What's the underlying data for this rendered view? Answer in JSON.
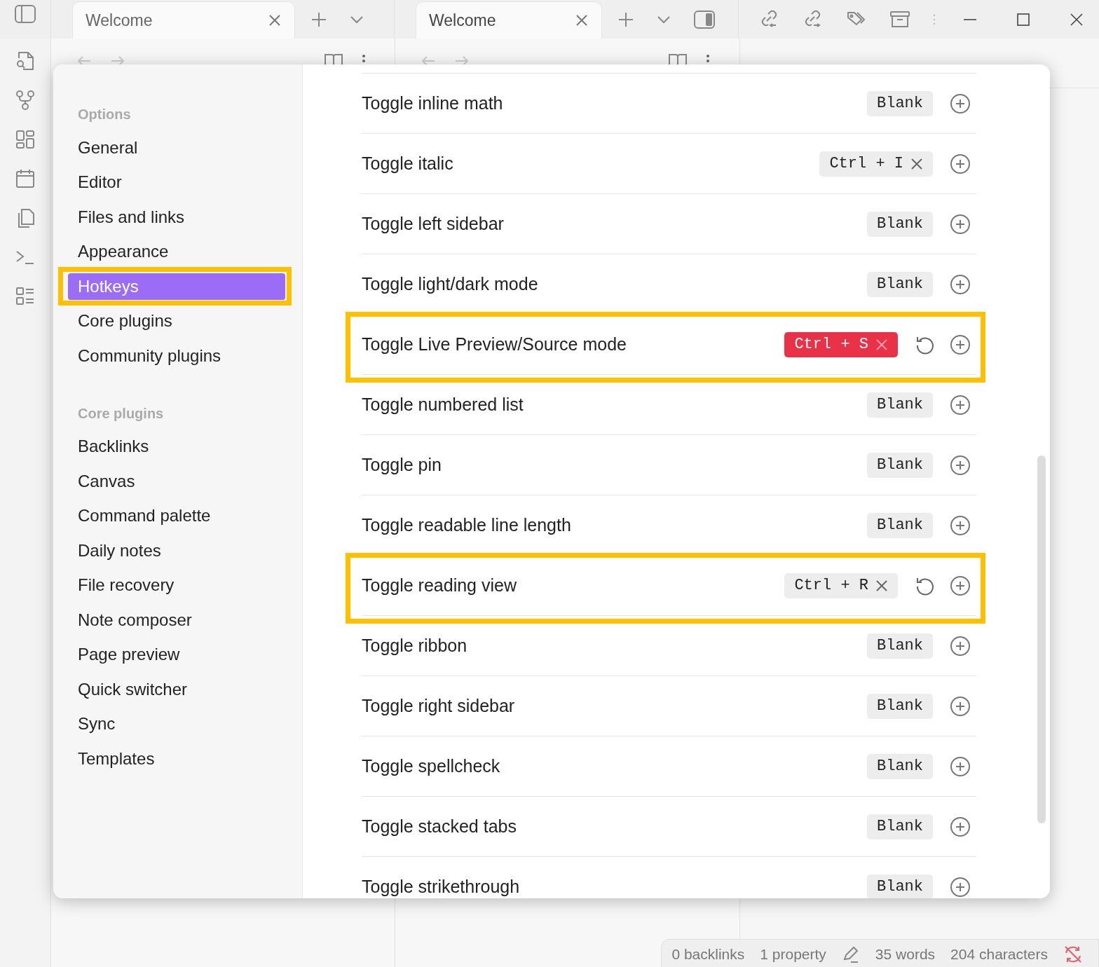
{
  "top_bar": {
    "panes": [
      {
        "tabs": [
          {
            "title": "Welcome",
            "selected": true
          }
        ]
      },
      {
        "tabs": [
          {
            "title": "Welcome",
            "selected": true
          }
        ]
      }
    ]
  },
  "settings": {
    "nav": [
      {
        "heading": "Options",
        "items": [
          {
            "label": "General",
            "selected": false,
            "highlighted": false
          },
          {
            "label": "Editor",
            "selected": false,
            "highlighted": false
          },
          {
            "label": "Files and links",
            "selected": false,
            "highlighted": false
          },
          {
            "label": "Appearance",
            "selected": false,
            "highlighted": false
          },
          {
            "label": "Hotkeys",
            "selected": true,
            "highlighted": true
          },
          {
            "label": "Core plugins",
            "selected": false,
            "highlighted": false
          },
          {
            "label": "Community plugins",
            "selected": false,
            "highlighted": false
          }
        ]
      },
      {
        "heading": "Core plugins",
        "items": [
          {
            "label": "Backlinks",
            "selected": false,
            "highlighted": false
          },
          {
            "label": "Canvas",
            "selected": false,
            "highlighted": false
          },
          {
            "label": "Command palette",
            "selected": false,
            "highlighted": false
          },
          {
            "label": "Daily notes",
            "selected": false,
            "highlighted": false
          },
          {
            "label": "File recovery",
            "selected": false,
            "highlighted": false
          },
          {
            "label": "Note composer",
            "selected": false,
            "highlighted": false
          },
          {
            "label": "Page preview",
            "selected": false,
            "highlighted": false
          },
          {
            "label": "Quick switcher",
            "selected": false,
            "highlighted": false
          },
          {
            "label": "Sync",
            "selected": false,
            "highlighted": false
          },
          {
            "label": "Templates",
            "selected": false,
            "highlighted": false
          }
        ]
      }
    ],
    "hotkeys": [
      {
        "command": "Toggle inline math",
        "binding": "Blank",
        "kind": "blank",
        "conflict": false,
        "customized": false,
        "highlighted": false
      },
      {
        "command": "Toggle italic",
        "binding": "Ctrl + I",
        "kind": "keys",
        "conflict": false,
        "customized": false,
        "highlighted": false
      },
      {
        "command": "Toggle left sidebar",
        "binding": "Blank",
        "kind": "blank",
        "conflict": false,
        "customized": false,
        "highlighted": false
      },
      {
        "command": "Toggle light/dark mode",
        "binding": "Blank",
        "kind": "blank",
        "conflict": false,
        "customized": false,
        "highlighted": false
      },
      {
        "command": "Toggle Live Preview/Source mode",
        "binding": "Ctrl + S",
        "kind": "keys",
        "conflict": true,
        "customized": true,
        "highlighted": true
      },
      {
        "command": "Toggle numbered list",
        "binding": "Blank",
        "kind": "blank",
        "conflict": false,
        "customized": false,
        "highlighted": false
      },
      {
        "command": "Toggle pin",
        "binding": "Blank",
        "kind": "blank",
        "conflict": false,
        "customized": false,
        "highlighted": false
      },
      {
        "command": "Toggle readable line length",
        "binding": "Blank",
        "kind": "blank",
        "conflict": false,
        "customized": false,
        "highlighted": false
      },
      {
        "command": "Toggle reading view",
        "binding": "Ctrl + R",
        "kind": "keys",
        "conflict": false,
        "customized": true,
        "highlighted": true
      },
      {
        "command": "Toggle ribbon",
        "binding": "Blank",
        "kind": "blank",
        "conflict": false,
        "customized": false,
        "highlighted": false
      },
      {
        "command": "Toggle right sidebar",
        "binding": "Blank",
        "kind": "blank",
        "conflict": false,
        "customized": false,
        "highlighted": false
      },
      {
        "command": "Toggle spellcheck",
        "binding": "Blank",
        "kind": "blank",
        "conflict": false,
        "customized": false,
        "highlighted": false
      },
      {
        "command": "Toggle stacked tabs",
        "binding": "Blank",
        "kind": "blank",
        "conflict": false,
        "customized": false,
        "highlighted": false
      },
      {
        "command": "Toggle strikethrough",
        "binding": "Blank",
        "kind": "blank",
        "conflict": false,
        "customized": false,
        "highlighted": false
      }
    ]
  },
  "status_bar": {
    "backlinks": "0 backlinks",
    "properties": "1 property",
    "words": "35 words",
    "characters": "204 characters"
  }
}
